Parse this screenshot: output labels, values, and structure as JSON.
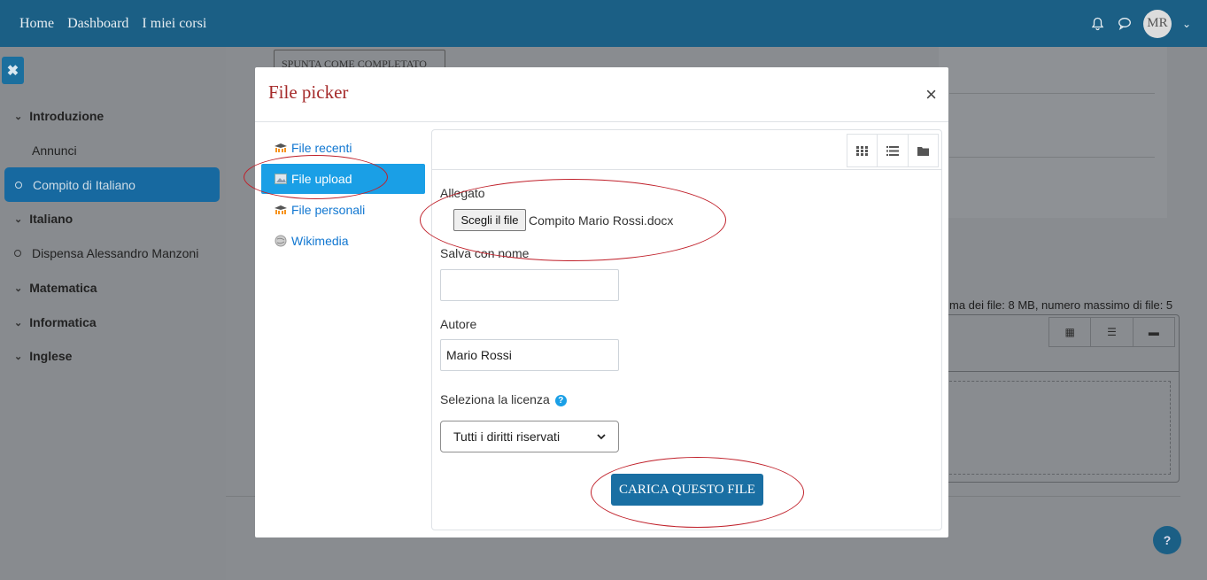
{
  "navbar": {
    "links": [
      "Home",
      "Dashboard",
      "I miei corsi"
    ],
    "avatar_initials": "MR",
    "icons": [
      "bell-icon",
      "chat-icon",
      "chevron-down-icon"
    ]
  },
  "drawer": {
    "items": [
      {
        "label": "Introduzione",
        "type": "section"
      },
      {
        "label": "Annunci",
        "type": "link"
      },
      {
        "label": "Compito di Italiano",
        "type": "active"
      },
      {
        "label": "Italiano",
        "type": "section"
      },
      {
        "label": "Dispensa Alessandro Manzoni",
        "type": "activity"
      },
      {
        "label": "Matematica",
        "type": "section"
      },
      {
        "label": "Informatica",
        "type": "section"
      },
      {
        "label": "Inglese",
        "type": "section"
      }
    ]
  },
  "background": {
    "mark_complete_button": "SPUNTA COME COMPLETATO",
    "file_limits_text": "ma dei file: 8 MB, numero massimo di file: 5",
    "help_button": "?"
  },
  "modal": {
    "title": "File picker",
    "close": "×",
    "repositories": [
      {
        "label": "File recenti",
        "icon": "moodle-icon",
        "active": false
      },
      {
        "label": "File upload",
        "icon": "upload-icon",
        "active": true
      },
      {
        "label": "File personali",
        "icon": "moodle-icon",
        "active": false
      },
      {
        "label": "Wikimedia",
        "icon": "wikimedia-icon",
        "active": false
      }
    ],
    "form": {
      "attachment_label": "Allegato",
      "choose_file_button": "Scegli il file",
      "chosen_file_name": "Compito Mario Rossi.docx",
      "save_as_label": "Salva con nome",
      "save_as_value": "",
      "author_label": "Autore",
      "author_value": "Mario Rossi",
      "license_label": "Seleziona la licenza",
      "license_value": "Tutti i diritti riservati",
      "upload_button": "CARICA QUESTO FILE"
    }
  },
  "colors": {
    "navbar": "#1b5f85",
    "accent": "#1a9fe6",
    "upload_button": "#1a6fa3",
    "annotation": "#c0202a",
    "title": "#a52a2a"
  }
}
